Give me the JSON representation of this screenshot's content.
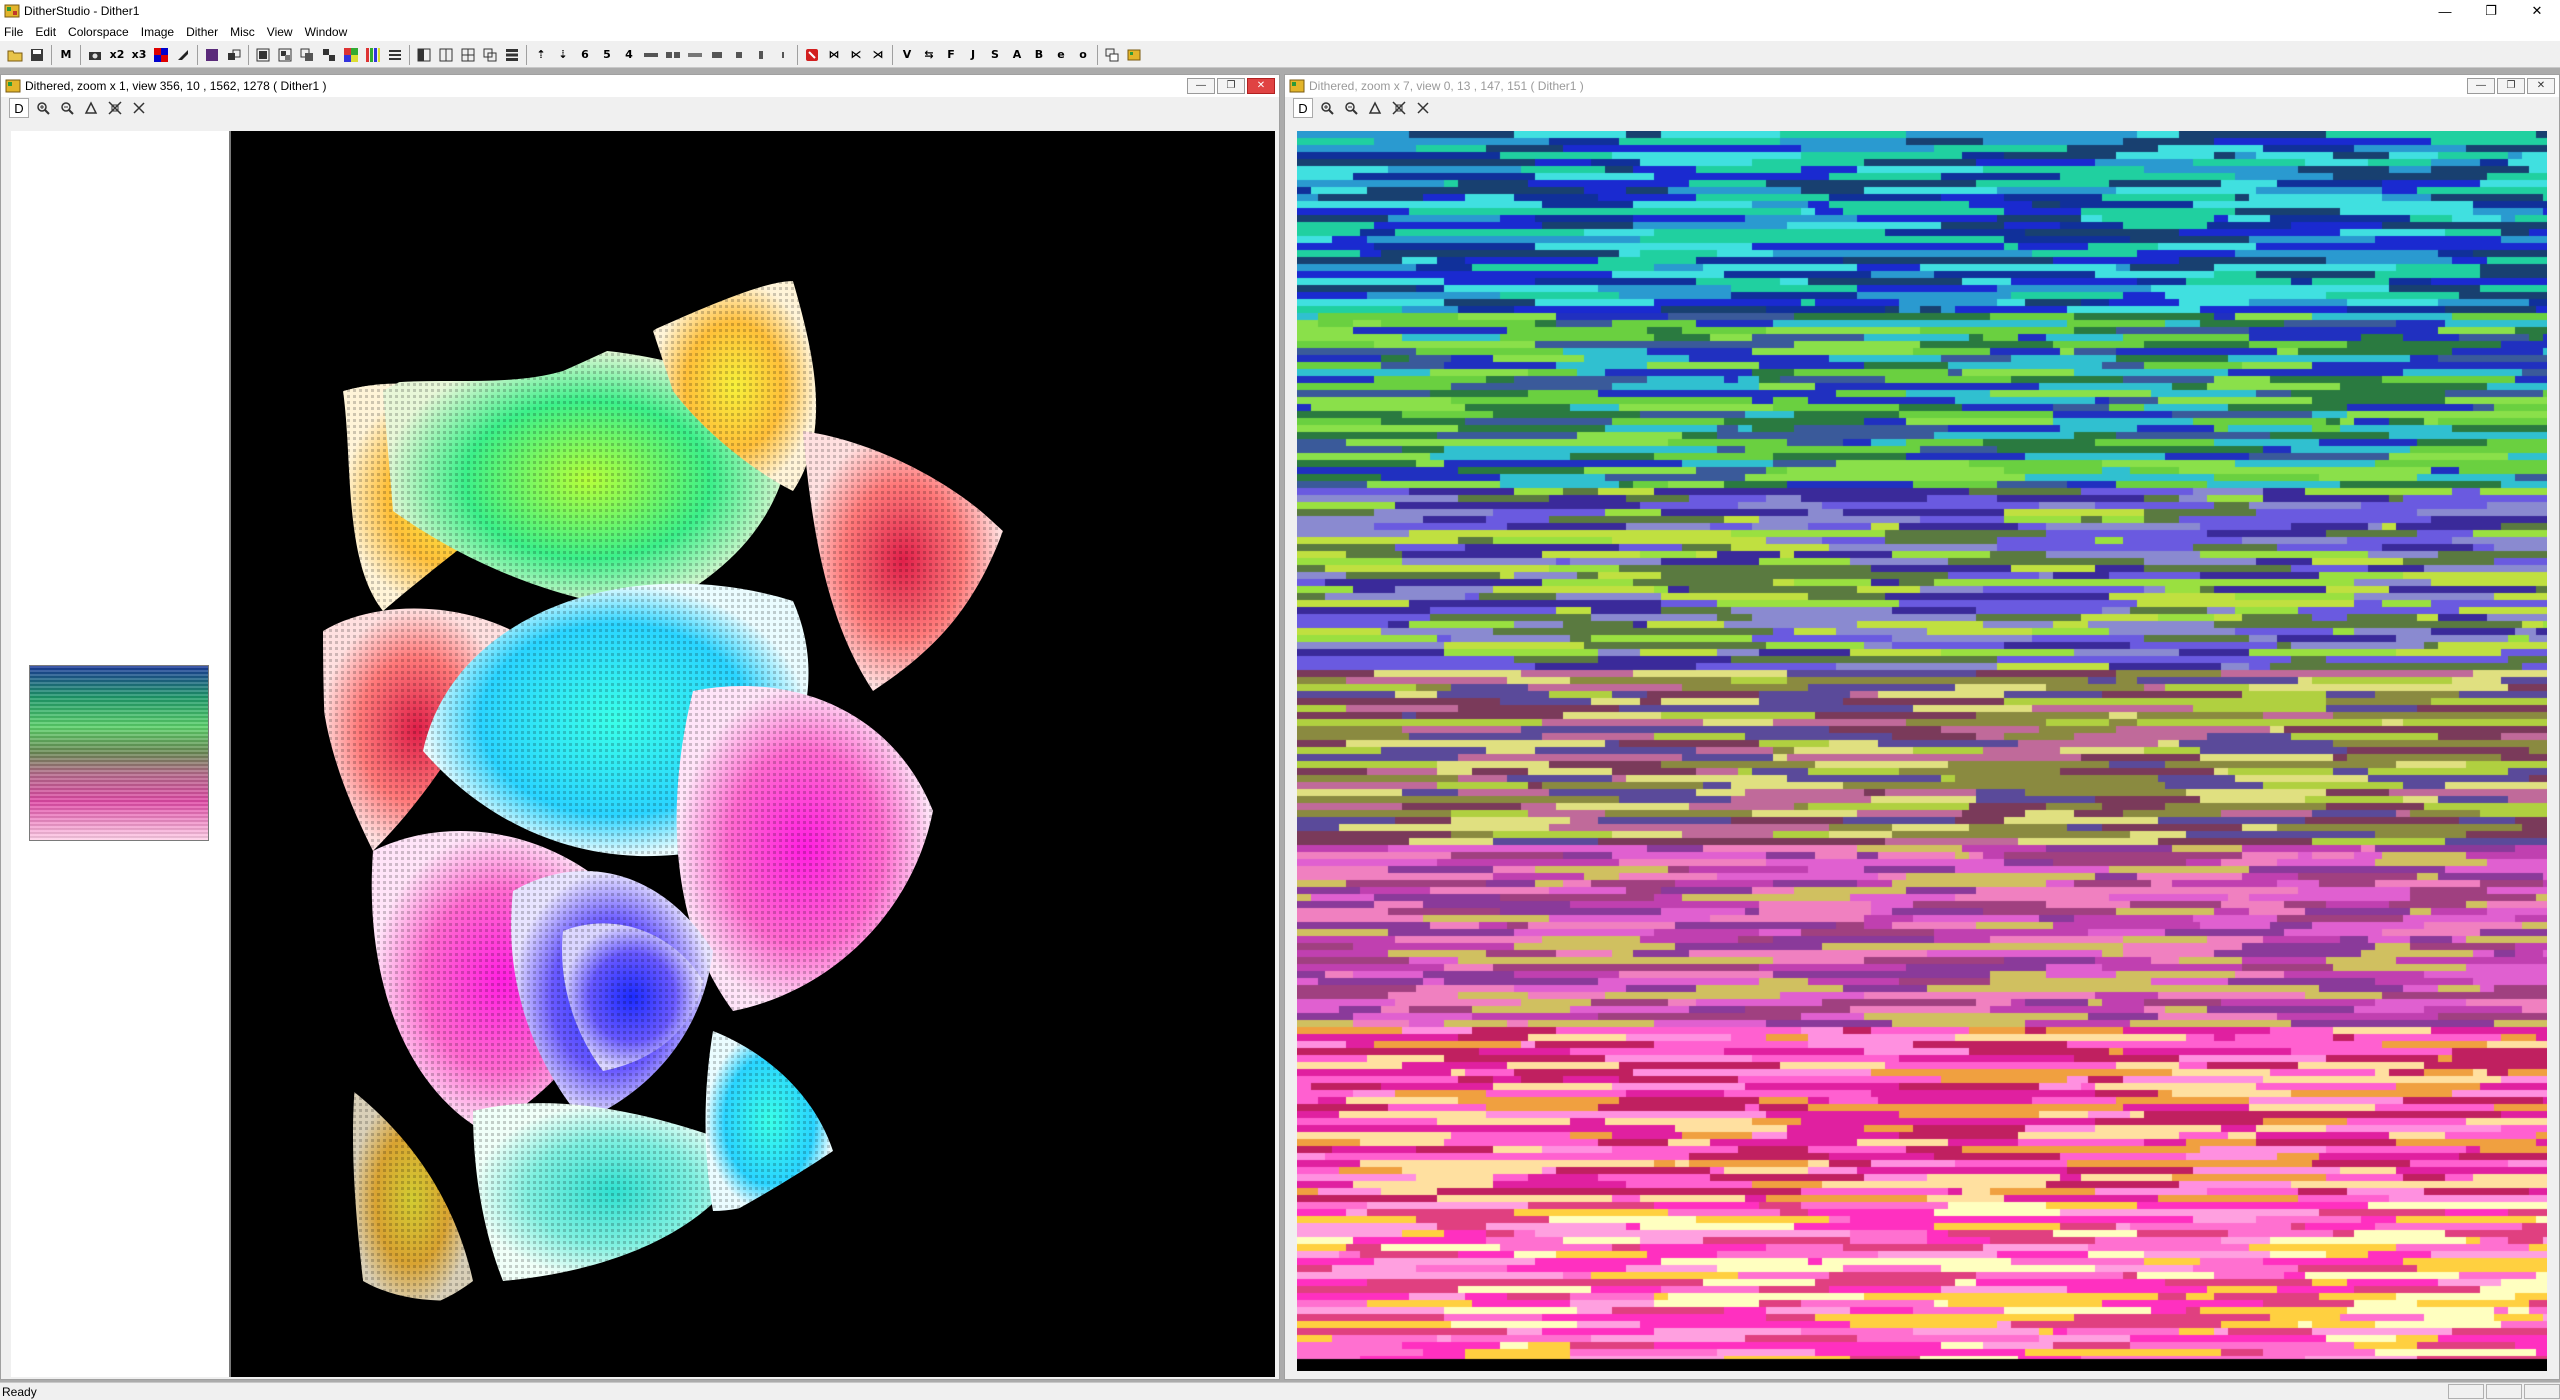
{
  "window": {
    "title": "DitherStudio - Dither1",
    "minimize_glyph": "—",
    "restore_glyph": "❐",
    "close_glyph": "✕"
  },
  "menu": [
    "File",
    "Edit",
    "Colorspace",
    "Image",
    "Dither",
    "Misc",
    "View",
    "Window"
  ],
  "toolbar": {
    "text_buttons": {
      "m": "M",
      "x2": "x2",
      "x3": "x3",
      "n6": "6",
      "n5": "5",
      "n4": "4",
      "v": "V",
      "f": "F",
      "j": "J",
      "s": "S",
      "a": "A",
      "b": "B",
      "e": "e",
      "o": "o"
    }
  },
  "left_window": {
    "title": "Dithered, zoom x 1, view 356, 10 , 1562, 1278 ( Dither1 )",
    "d_button": "D"
  },
  "right_window": {
    "title": "Dithered, zoom x 7, view 0, 13 , 147, 151 ( Dither1 )",
    "d_button": "D"
  },
  "status": {
    "text": "Ready"
  },
  "colors": {
    "mdi_background": "#ababab",
    "canvas_background": "#000000",
    "close_button": "#e04343"
  }
}
